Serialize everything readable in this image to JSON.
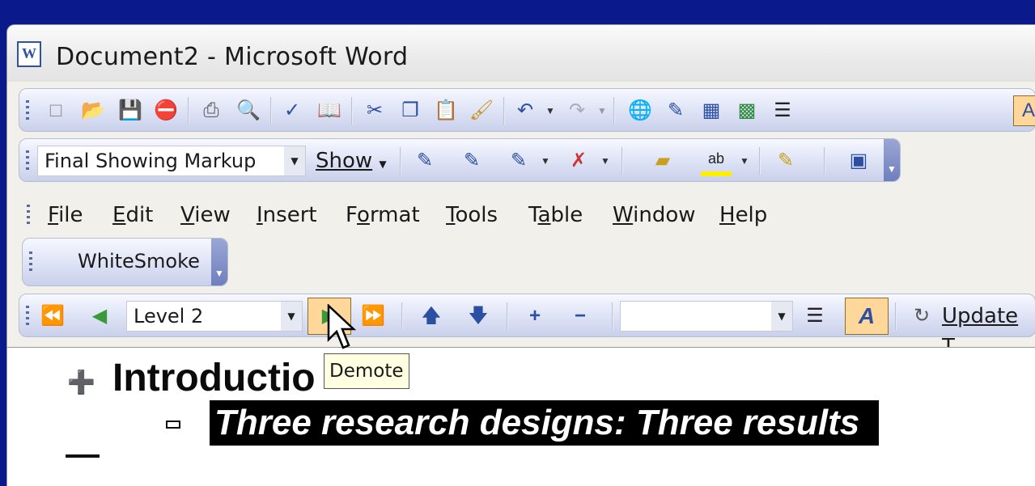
{
  "window": {
    "title": "Document2 - Microsoft Word",
    "app_icon_letter": "W"
  },
  "standard_toolbar": {
    "buttons": [
      "new-icon",
      "open-icon",
      "save-icon",
      "permission-icon",
      "print-icon",
      "print-preview-icon",
      "spelling-icon",
      "research-icon",
      "cut-icon",
      "copy-icon",
      "paste-icon",
      "format-painter-icon",
      "undo-icon",
      "redo-icon",
      "hyperlink-icon",
      "tables-borders-icon",
      "insert-table-icon",
      "insert-excel-icon",
      "columns-icon",
      "drawing-icon"
    ]
  },
  "reviewing_toolbar": {
    "display_mode": "Final Showing Markup",
    "show_label": "Show"
  },
  "menubar": {
    "items": [
      {
        "accel": "F",
        "rest": "ile"
      },
      {
        "accel": "E",
        "rest": "dit"
      },
      {
        "accel": "V",
        "rest": "iew"
      },
      {
        "accel": "I",
        "rest": "nsert"
      },
      {
        "pre": "F",
        "accel": "o",
        "rest": "rmat"
      },
      {
        "accel": "T",
        "rest": "ools"
      },
      {
        "pre": "T",
        "accel": "a",
        "rest": "ble"
      },
      {
        "accel": "W",
        "rest": "indow"
      },
      {
        "accel": "H",
        "rest": "elp"
      }
    ]
  },
  "style_toolbar": {
    "label": "WhiteSmoke"
  },
  "outlining_toolbar": {
    "level": "Level 2",
    "update_label": "Update T"
  },
  "tooltip": {
    "text": "Demote"
  },
  "document": {
    "heading": "Introductio",
    "selected_line": "Three research designs: Three results"
  },
  "colors": {
    "desktop": "#0a1a8a",
    "highlight": "#ffd79a",
    "tooltip_bg": "#ffffe1"
  }
}
